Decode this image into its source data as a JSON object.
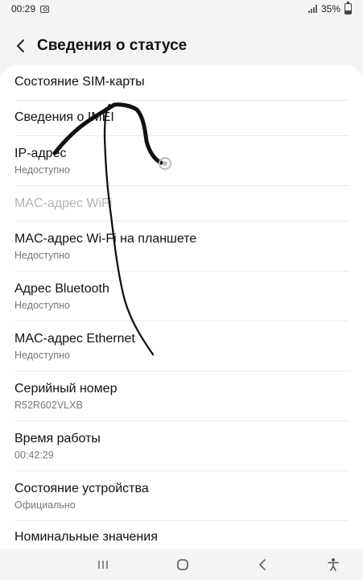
{
  "status_bar": {
    "time": "00:29",
    "battery": "35%"
  },
  "header": {
    "title": "Сведения о статусе"
  },
  "items": [
    {
      "title": "Состояние SIM-карты",
      "subtitle": ""
    },
    {
      "title": "Сведения о IMEI",
      "subtitle": ""
    },
    {
      "title": "IP-адрес",
      "subtitle": "Недоступно"
    },
    {
      "title": "MAC-адрес WiFi",
      "subtitle": ""
    },
    {
      "title": "MAC-адрес Wi-Fi на планшете",
      "subtitle": "Недоступно"
    },
    {
      "title": "Адрес Bluetooth",
      "subtitle": "Недоступно"
    },
    {
      "title": "MAC-адрес Ethernet",
      "subtitle": "Недоступно"
    },
    {
      "title": "Серийный номер",
      "subtitle": "R52R602VLXB"
    },
    {
      "title": "Время работы",
      "subtitle": "00:42:29"
    },
    {
      "title": "Состояние устройства",
      "subtitle": "Официально"
    },
    {
      "title": "Номинальные значения",
      "subtitle": ""
    }
  ],
  "icons": {
    "back": "chevron-left-icon",
    "screenshot": "screenshot-icon",
    "signal": "signal-icon",
    "battery": "battery-icon",
    "recents": "recents-icon",
    "home": "home-icon",
    "nav_back": "back-icon",
    "accessibility": "accessibility-icon"
  },
  "colors": {
    "background": "#f4f4f6",
    "card": "#ffffff",
    "disabled_text": "#b4b4b4",
    "secondary_text": "#777777"
  }
}
